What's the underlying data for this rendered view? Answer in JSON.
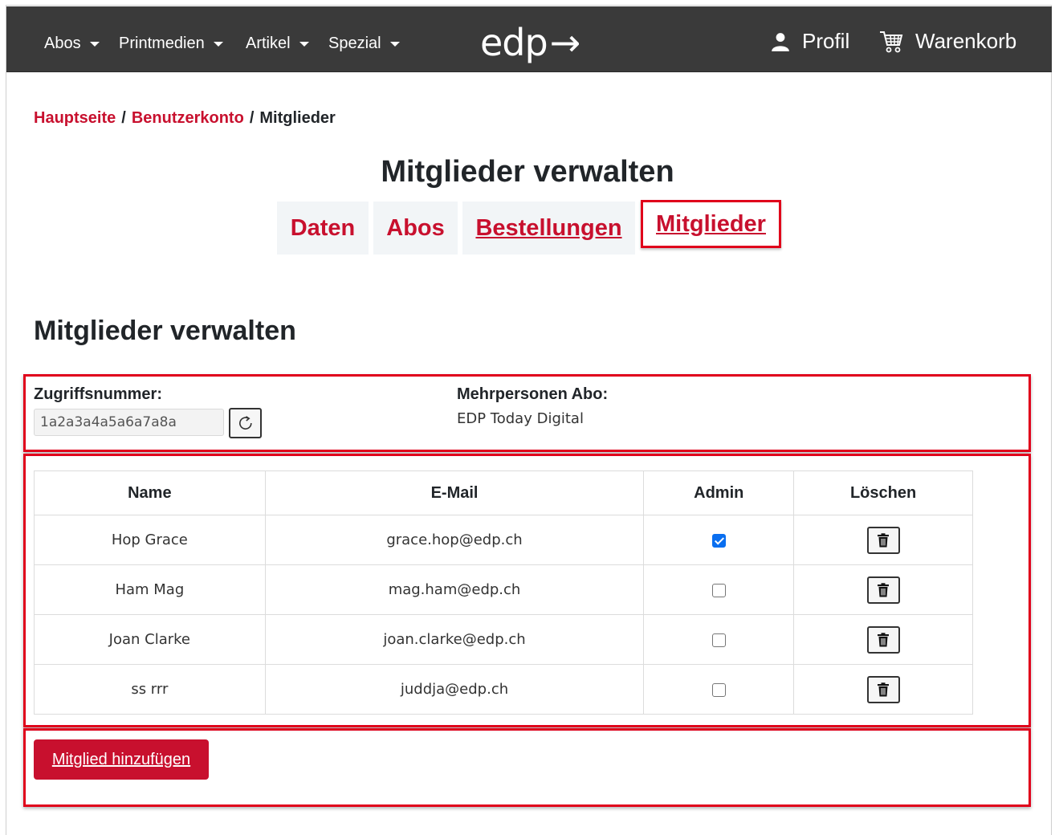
{
  "nav": {
    "menu": [
      {
        "label": "Abos"
      },
      {
        "label": "Printmedien"
      },
      {
        "label": "Artikel"
      },
      {
        "label": "Spezial"
      }
    ],
    "logo_text": "edp",
    "logo_arrow": "→",
    "profile_label": "Profil",
    "cart_label": "Warenkorb",
    "icons": {
      "profile": "user-icon",
      "cart": "shopping-cart-icon"
    }
  },
  "breadcrumb": {
    "home": "Hauptseite",
    "account": "Benutzerkonto",
    "current": "Mitglieder",
    "separator": "/"
  },
  "page_title": "Mitglieder verwalten",
  "tabs": [
    {
      "label": "Daten"
    },
    {
      "label": "Abos"
    },
    {
      "label": "Bestellungen"
    },
    {
      "label": "Mitglieder",
      "active": true
    }
  ],
  "section_title": "Mitglieder verwalten",
  "access": {
    "label": "Zugriffsnummer:",
    "value": "1a2a3a4a5a6a7a8a",
    "refresh_icon": "refresh-icon"
  },
  "subscription": {
    "label": "Mehrpersonen Abo:",
    "value": "EDP Today Digital"
  },
  "table": {
    "headers": [
      "Name",
      "E-Mail",
      "Admin",
      "Löschen"
    ],
    "rows": [
      {
        "name": "Hop Grace",
        "email": "grace.hop@edp.ch",
        "admin": true
      },
      {
        "name": "Ham Mag",
        "email": "mag.ham@edp.ch",
        "admin": false
      },
      {
        "name": "Joan Clarke",
        "email": "joan.clarke@edp.ch",
        "admin": false
      },
      {
        "name": "ss rrr",
        "email": "juddja@edp.ch",
        "admin": false
      }
    ]
  },
  "add_member_label": "Mitglied hinzufügen",
  "colors": {
    "accent": "#c8102e",
    "nav_bg": "#3a3a3a",
    "highlight": "#e0001b",
    "checkbox": "#0a6ff0"
  }
}
